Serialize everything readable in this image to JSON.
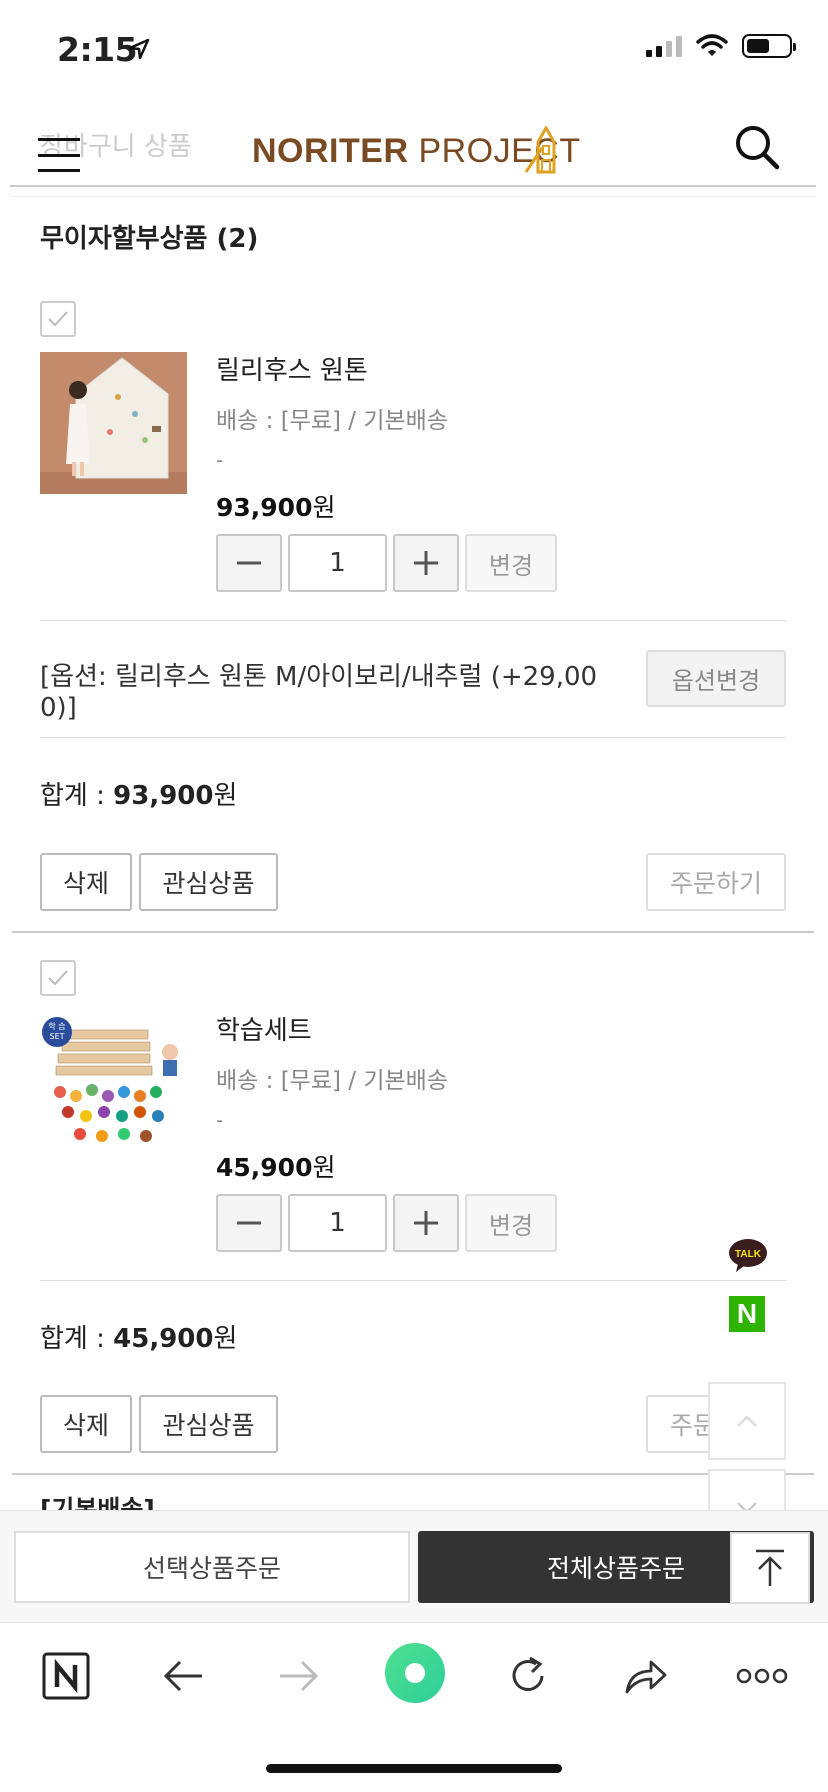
{
  "status_bar": {
    "time": "2:15"
  },
  "header": {
    "page_title": "장바구니 상품",
    "logo_bold": "NORITER",
    "logo_light": " PROJECT"
  },
  "section": {
    "title": "무이자할부상품 (2)"
  },
  "products": [
    {
      "name": "릴리후스 원톤",
      "shipping": "배송 : [무료] / 기본배송",
      "dash": "-",
      "price_num": "93,900",
      "price_unit": "원",
      "quantity": "1",
      "change_label": "변경",
      "option": "[옵션: 릴리후스 원톤 M/아이보리/내추럴 (+29,000)]",
      "option_line1": "[옵션: 릴리후스 원톤 M/아이보리/내추럴 (+29,00",
      "option_line2": "0)]",
      "option_button": "옵션변경",
      "total_label": "합계 : ",
      "total_num": "93,900",
      "total_unit": "원",
      "delete_label": "삭제",
      "wish_label": "관심상품",
      "order_label": "주문하기"
    },
    {
      "name": "학습세트",
      "shipping": "배송 : [무료] / 기본배송",
      "dash": "-",
      "price_num": "45,900",
      "price_unit": "원",
      "quantity": "1",
      "change_label": "변경",
      "badge_line1": "학 습",
      "badge_line2": "SET",
      "total_label": "합계 : ",
      "total_num": "45,900",
      "total_unit": "원",
      "delete_label": "삭제",
      "wish_label": "관심상품",
      "order_label": "주문"
    }
  ],
  "floating": {
    "talk_label": "TALK",
    "naver_label": "N"
  },
  "bottom_bar": {
    "select_order": "선택상품주문",
    "all_order": "전체상품주문"
  },
  "cut_text": "[기본배송]",
  "colors": {
    "accent_dark": "#333333",
    "logo_brown": "#7a4a22",
    "naver_green": "#2db400",
    "talk_yellow": "#3a1d1d"
  }
}
